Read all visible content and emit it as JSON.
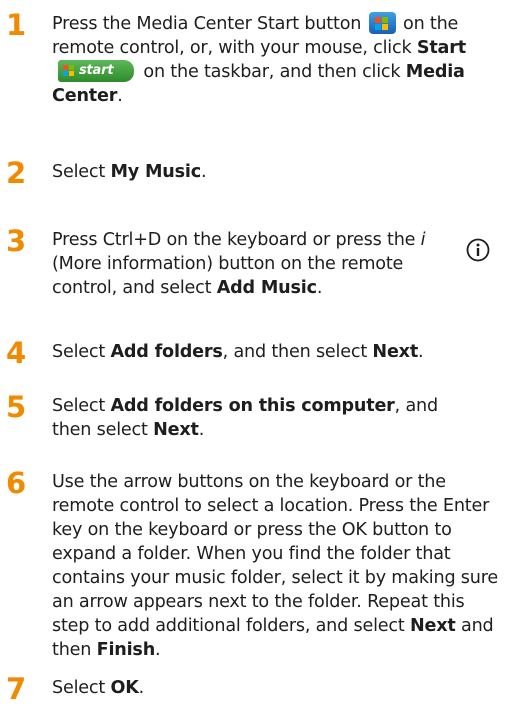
{
  "icons": {
    "media_center_start": "windows-logo-icon",
    "start_button": "start-button-icon",
    "info": "info-icon"
  },
  "start_button_label": "start",
  "steps": [
    {
      "number": "1",
      "t1": "Press the Media Center Start button ",
      "t2": " on the remote control, or, with your mouse, click ",
      "b1": "Start",
      "t3": " on the taskbar, and then click ",
      "b2": "Media Center",
      "t4": "."
    },
    {
      "number": "2",
      "t1": "Select ",
      "b1": "My Music",
      "t2": "."
    },
    {
      "number": "3",
      "t1": "Press Ctrl+D on the keyboard or press the ",
      "i1": "i",
      "t2": " (More information) button on the remote control, and select ",
      "b1": "Add Music",
      "t3": "."
    },
    {
      "number": "4",
      "t1": "Select ",
      "b1": "Add folders",
      "t2": ", and then select ",
      "b2": "Next",
      "t3": "."
    },
    {
      "number": "5",
      "t1": "Select ",
      "b1": "Add folders on this computer",
      "t2": ", and then select ",
      "b2": "Next",
      "t3": "."
    },
    {
      "number": "6",
      "t1": "Use the arrow buttons on the keyboard or the remote control to select a location. Press the Enter key on the keyboard or press the OK button to expand a folder. When you find the folder that contains your music folder, select it by making sure an arrow appears next to the folder. Repeat this step to add additional folders, and select ",
      "b1": "Next",
      "t2": " and then ",
      "b2": "Finish",
      "t3": "."
    },
    {
      "number": "7",
      "t1": "Select ",
      "b1": "OK",
      "t2": "."
    }
  ]
}
